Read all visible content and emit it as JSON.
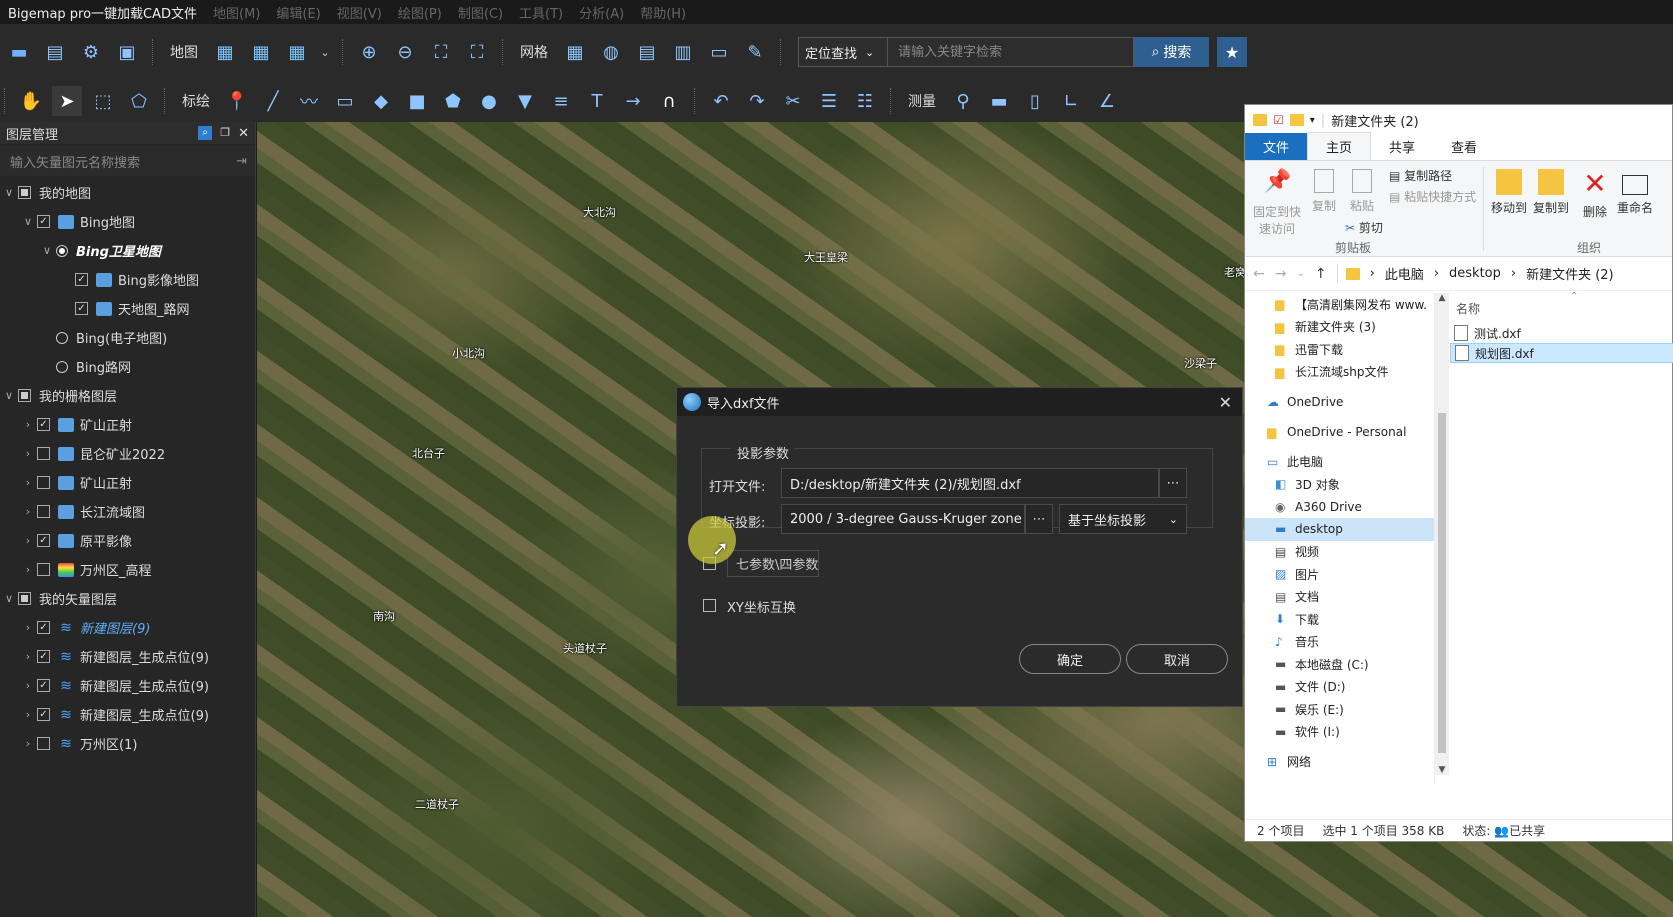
{
  "app": {
    "title": "Bigemap pro一键加载CAD文件",
    "menus": [
      "地图(M)",
      "编辑(E)",
      "视图(V)",
      "绘图(P)",
      "制图(C)",
      "工具(T)",
      "分析(A)",
      "帮助(H)"
    ]
  },
  "toolbar1": {
    "map_label": "地图",
    "grid_label": "网格",
    "locate_select": "定位查找",
    "search_placeholder": "请输入关键字检索",
    "search_button": "搜索"
  },
  "toolbar2": {
    "annotate_label": "标绘",
    "measure_label": "测量"
  },
  "layer_panel": {
    "title": "图层管理",
    "search_placeholder": "输入矢量图元名称搜索",
    "items": [
      {
        "label": "我的地图",
        "level": 0,
        "arrow": "∨",
        "check": "box"
      },
      {
        "label": "Bing地图",
        "level": 1,
        "arrow": "∨",
        "check": "checked",
        "icon": "img"
      },
      {
        "label": "Bing卫星地图",
        "level": 2,
        "arrow": "∨",
        "check": "radio-on",
        "style": "active"
      },
      {
        "label": "Bing影像地图",
        "level": 3,
        "arrow": "",
        "check": "checked",
        "icon": "img"
      },
      {
        "label": "天地图_路网",
        "level": 3,
        "arrow": "",
        "check": "checked",
        "icon": "img"
      },
      {
        "label": "Bing(电子地图)",
        "level": 2,
        "arrow": "",
        "check": "radio"
      },
      {
        "label": "Bing路网",
        "level": 2,
        "arrow": "",
        "check": "radio"
      },
      {
        "label": "我的栅格图层",
        "level": 0,
        "arrow": "∨",
        "check": "box"
      },
      {
        "label": "矿山正射",
        "level": 1,
        "arrow": "›",
        "check": "checked",
        "icon": "img"
      },
      {
        "label": "昆仑矿业2022",
        "level": 1,
        "arrow": "›",
        "check": "unchecked",
        "icon": "img"
      },
      {
        "label": "矿山正射",
        "level": 1,
        "arrow": "›",
        "check": "unchecked",
        "icon": "img"
      },
      {
        "label": "长江流域图",
        "level": 1,
        "arrow": "›",
        "check": "unchecked",
        "icon": "img"
      },
      {
        "label": "原平影像",
        "level": 1,
        "arrow": "›",
        "check": "checked",
        "icon": "img"
      },
      {
        "label": "万州区_高程",
        "level": 1,
        "arrow": "›",
        "check": "unchecked",
        "icon": "grad"
      },
      {
        "label": "我的矢量图层",
        "level": 0,
        "arrow": "∨",
        "check": "box"
      },
      {
        "label": "新建图层(9)",
        "level": 1,
        "arrow": "›",
        "check": "checked",
        "icon": "layer",
        "style": "blue"
      },
      {
        "label": "新建图层_生成点位(9)",
        "level": 1,
        "arrow": "›",
        "check": "checked",
        "icon": "layer"
      },
      {
        "label": "新建图层_生成点位(9)",
        "level": 1,
        "arrow": "›",
        "check": "checked",
        "icon": "layer"
      },
      {
        "label": "新建图层_生成点位(9)",
        "level": 1,
        "arrow": "›",
        "check": "checked",
        "icon": "layer"
      },
      {
        "label": "万州区(1)",
        "level": 1,
        "arrow": "›",
        "check": "unchecked",
        "icon": "layer"
      }
    ]
  },
  "map_labels": {
    "l1": "大北沟",
    "l2": "大王皇梁",
    "l3": "小北沟",
    "l4": "北台子",
    "l5": "南沟",
    "l6": "头道杖子",
    "l7": "二道杖子",
    "l8": "老窝",
    "l9": "沙梁子"
  },
  "dialog": {
    "title": "导入dxf文件",
    "group_title": "投影参数",
    "open_file_label": "打开文件:",
    "open_file_value": "D:/desktop/新建文件夹 (2)/规划图.dxf",
    "proj_label": "坐标投影:",
    "proj_value": "2000 / 3-degree Gauss-Kruger zone 40",
    "proj_mode": "基于坐标投影",
    "seven_params": "七参数\\四参数",
    "xy_swap": "XY坐标互换",
    "ok": "确定",
    "cancel": "取消"
  },
  "explorer": {
    "title": "新建文件夹 (2)",
    "tabs": [
      "文件",
      "主页",
      "共享",
      "查看"
    ],
    "ribbon": {
      "pin": "固定到快速访问",
      "copy": "复制",
      "paste": "粘贴",
      "copy_path": "复制路径",
      "paste_shortcut": "粘贴快捷方式",
      "cut": "剪切",
      "clipboard": "剪贴板",
      "move_to": "移动到",
      "copy_to": "复制到",
      "delete": "删除",
      "rename": "重命名",
      "organize": "组织"
    },
    "path": [
      "此电脑",
      "desktop",
      "新建文件夹 (2)"
    ],
    "nav": [
      {
        "label": "【高清剧集网发布 www.",
        "icon": "folder"
      },
      {
        "label": "新建文件夹 (3)",
        "icon": "folder"
      },
      {
        "label": "迅雷下载",
        "icon": "folder"
      },
      {
        "label": "长江流域shp文件",
        "icon": "folder"
      },
      {
        "label": "OneDrive",
        "icon": "cloud",
        "gap": true
      },
      {
        "label": "OneDrive - Personal",
        "icon": "folder",
        "gap": true
      },
      {
        "label": "此电脑",
        "icon": "pc",
        "gap": true
      },
      {
        "label": "3D 对象",
        "icon": "cube"
      },
      {
        "label": "A360 Drive",
        "icon": "drive"
      },
      {
        "label": "desktop",
        "icon": "desktop",
        "selected": true
      },
      {
        "label": "视频",
        "icon": "video"
      },
      {
        "label": "图片",
        "icon": "picture"
      },
      {
        "label": "文档",
        "icon": "doc"
      },
      {
        "label": "下载",
        "icon": "download"
      },
      {
        "label": "音乐",
        "icon": "music"
      },
      {
        "label": "本地磁盘 (C:)",
        "icon": "disk"
      },
      {
        "label": "文件 (D:)",
        "icon": "disk"
      },
      {
        "label": "娱乐 (E:)",
        "icon": "disk"
      },
      {
        "label": "软件 (I:)",
        "icon": "disk"
      },
      {
        "label": "网络",
        "icon": "network",
        "gap": true
      }
    ],
    "column_name": "名称",
    "files": [
      {
        "name": "测试.dxf",
        "selected": false
      },
      {
        "name": "规划图.dxf",
        "selected": true
      }
    ],
    "status": {
      "count": "2 个项目",
      "selected": "选中 1 个项目  358 KB",
      "state": "状态:",
      "shared": "已共享"
    }
  }
}
